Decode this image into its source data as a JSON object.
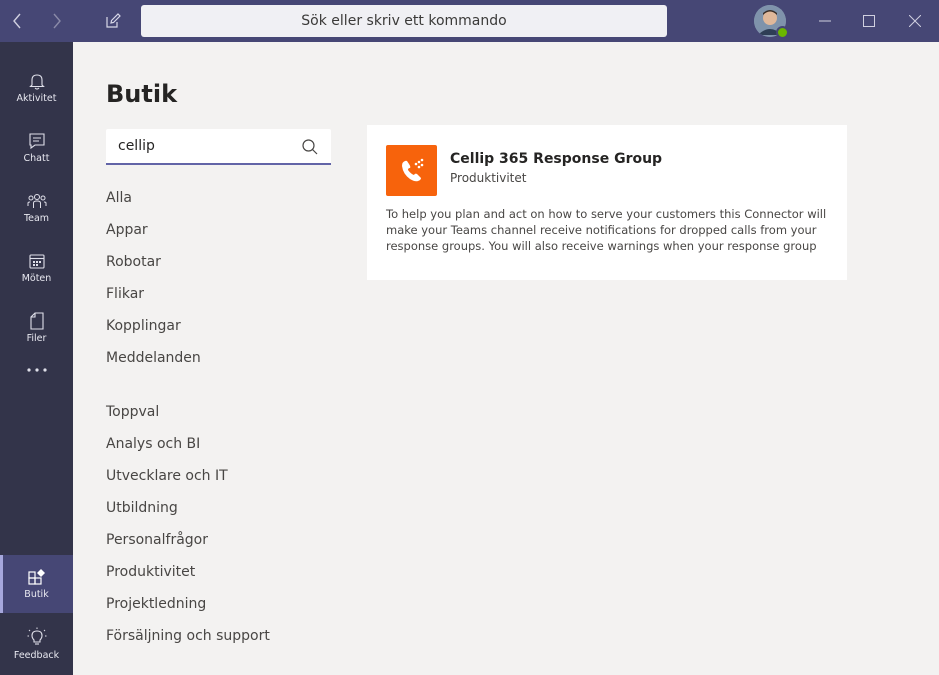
{
  "titlebar": {
    "search_placeholder": "Sök eller skriv ett kommando"
  },
  "rail": {
    "items": [
      {
        "label": "Aktivitet",
        "icon": "bell-icon"
      },
      {
        "label": "Chatt",
        "icon": "chat-icon"
      },
      {
        "label": "Team",
        "icon": "team-icon"
      },
      {
        "label": "Möten",
        "icon": "calendar-icon"
      },
      {
        "label": "Filer",
        "icon": "file-icon"
      },
      {
        "label": "Butik",
        "icon": "store-icon",
        "active": true
      },
      {
        "label": "Feedback",
        "icon": "lightbulb-icon"
      }
    ]
  },
  "main": {
    "title": "Butik",
    "search_value": "cellip",
    "categories_top": [
      "Alla",
      "Appar",
      "Robotar",
      "Flikar",
      "Kopplingar",
      "Meddelanden"
    ],
    "categories_bottom": [
      "Toppval",
      "Analys och BI",
      "Utvecklare och IT",
      "Utbildning",
      "Personalfrågor",
      "Produktivitet",
      "Projektledning",
      "Försäljning och support"
    ]
  },
  "result": {
    "name": "Cellip 365 Response Group",
    "category": "Produktivitet",
    "description": "To help you plan and act on how to serve your customers this Connector will make your Teams channel receive notifications for dropped calls from your response groups. You will also receive warnings when your response group"
  },
  "colors": {
    "titlebar": "#464775",
    "rail": "#33344a",
    "accent": "#6264a7",
    "app_icon": "#f7630c"
  }
}
